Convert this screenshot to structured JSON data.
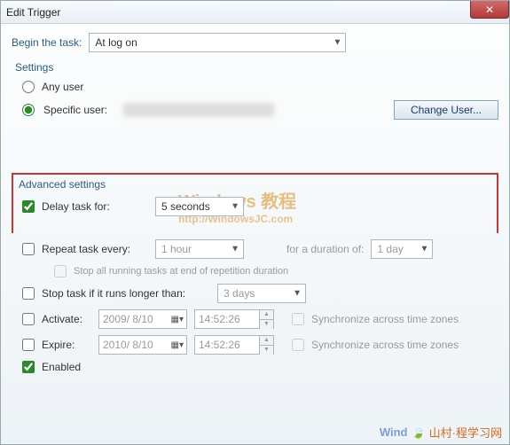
{
  "window": {
    "title": "Edit Trigger"
  },
  "begin": {
    "label": "Begin the task:",
    "value": "At log on"
  },
  "settings": {
    "header": "Settings",
    "any_user": "Any user",
    "specific_user": "Specific user:",
    "change_user_btn": "Change User..."
  },
  "watermark": {
    "line1": "Windows 教程",
    "line2": "http://WindowsJC.com"
  },
  "advanced": {
    "header": "Advanced settings",
    "delay": {
      "label": "Delay task for:",
      "value": "5 seconds"
    },
    "repeat": {
      "label": "Repeat task every:",
      "value": "1 hour",
      "duration_label": "for a duration of:",
      "duration_value": "1 day"
    },
    "stop_running": "Stop all running tasks at end of repetition duration",
    "stop_longer": {
      "label": "Stop task if it runs longer than:",
      "value": "3 days"
    },
    "activate": {
      "label": "Activate:",
      "date": "2009/ 8/10",
      "time": "14:52:26",
      "sync": "Synchronize across time zones"
    },
    "expire": {
      "label": "Expire:",
      "date": "2010/ 8/10",
      "time": "14:52:26",
      "sync": "Synchronize across time zones"
    },
    "enabled": "Enabled"
  },
  "bottom_watermark": {
    "logo": "Wind",
    "text": "山村·程学习网"
  }
}
